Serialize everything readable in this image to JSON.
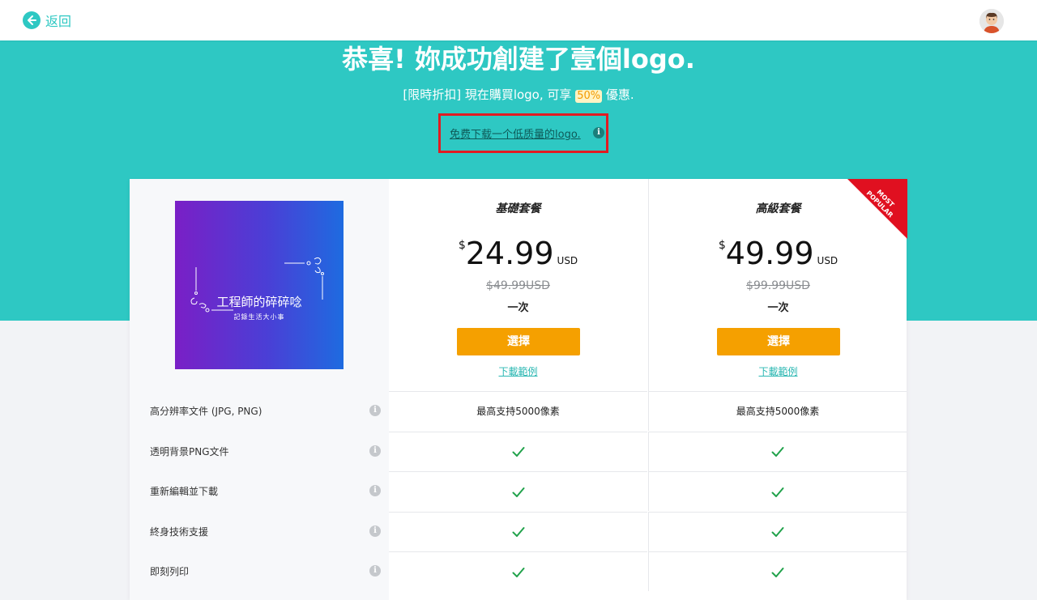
{
  "header": {
    "back_label": "返回"
  },
  "hero": {
    "title": "恭喜! 妳成功創建了壹個logo.",
    "subtitle_prefix": "[限時折扣] 現在購買logo, 可享",
    "discount": "50%",
    "subtitle_suffix": "優惠.",
    "free_download_link": "免费下载一个低质量的logo."
  },
  "logo_preview": {
    "title": "工程師的碎碎唸",
    "tagline": "記錄生活大小事"
  },
  "plans": [
    {
      "name": "基礎套餐",
      "currency_symbol": "$",
      "price": "24.99",
      "currency": "USD",
      "old_price": "$49.99USD",
      "period": "一次",
      "select_label": "選擇",
      "sample_link": "下載範例"
    },
    {
      "name": "高級套餐",
      "currency_symbol": "$",
      "price": "49.99",
      "currency": "USD",
      "old_price": "$99.99USD",
      "period": "一次",
      "select_label": "選擇",
      "sample_link": "下載範例",
      "ribbon": "MOST POPULAR"
    }
  ],
  "features": [
    {
      "label": "高分辨率文件 (JPG, PNG)",
      "basic": "最高支持5000像素",
      "pro": "最高支持5000像素"
    },
    {
      "label": "透明背景PNG文件",
      "basic": "check",
      "pro": "check"
    },
    {
      "label": "重新編輯並下載",
      "basic": "check",
      "pro": "check"
    },
    {
      "label": "終身技術支援",
      "basic": "check",
      "pro": "check"
    },
    {
      "label": "即刻列印",
      "basic": "check",
      "pro": "check"
    }
  ],
  "colors": {
    "teal": "#2ec8c3",
    "orange": "#f5a000",
    "red_highlight": "#e11b22",
    "check_green": "#21a24b"
  },
  "icons": {
    "back": "arrow-left-icon",
    "info": "info-icon",
    "check": "check-icon"
  }
}
